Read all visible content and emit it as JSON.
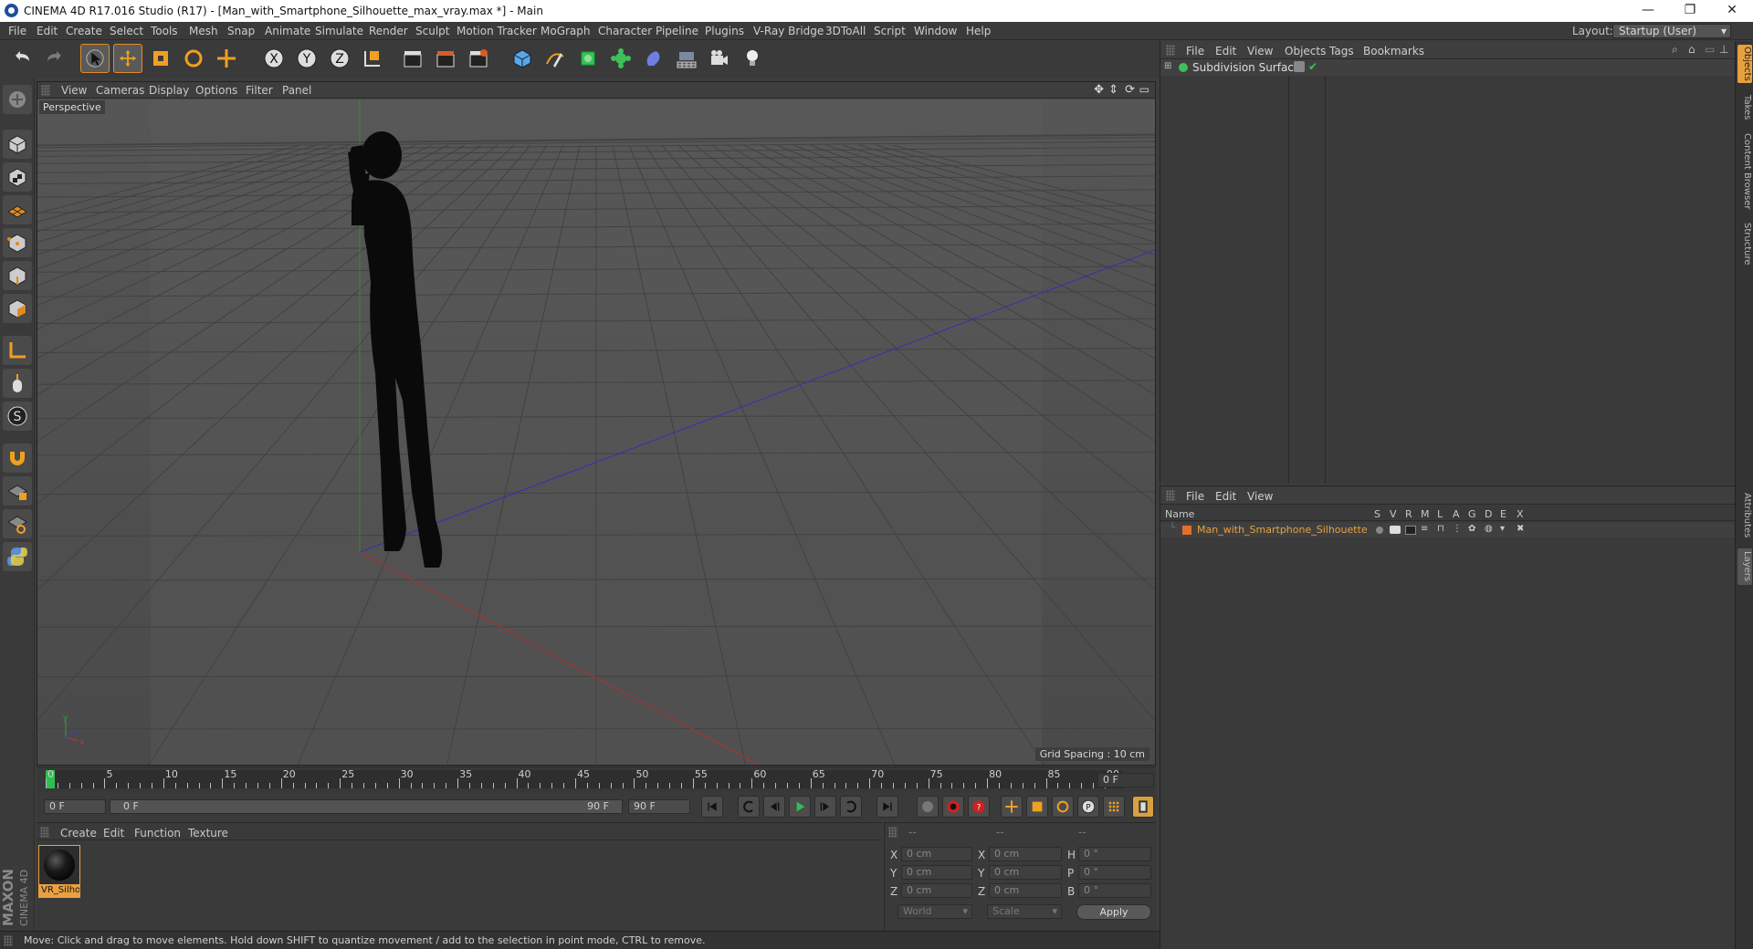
{
  "window": {
    "title": "CINEMA 4D R17.016 Studio (R17) - [Man_with_Smartphone_Silhouette_max_vray.max *] - Main",
    "min": "—",
    "restore": "❐",
    "close": "✕"
  },
  "menubar": {
    "items": [
      "File",
      "Edit",
      "Create",
      "Select",
      "Tools",
      "Mesh",
      "Snap",
      "Animate",
      "Simulate",
      "Render",
      "Sculpt",
      "Motion Tracker",
      "MoGraph",
      "Character",
      "Pipeline",
      "Plugins",
      "V-Ray Bridge",
      "3DToAll",
      "Script",
      "Window",
      "Help"
    ],
    "layout_label": "Layout:",
    "layout_value": "Startup (User)"
  },
  "viewport": {
    "menu": [
      "View",
      "Cameras",
      "Display",
      "Options",
      "Filter",
      "Panel"
    ],
    "label": "Perspective",
    "grid_info": "Grid Spacing : 10 cm",
    "axis_y": "y",
    "axis_x": "x",
    "axis_z": "z"
  },
  "timeline": {
    "ticks": [
      "0",
      "5",
      "10",
      "15",
      "20",
      "25",
      "30",
      "35",
      "40",
      "45",
      "50",
      "55",
      "60",
      "65",
      "70",
      "75",
      "80",
      "85",
      "90"
    ],
    "current_frame": "0 F",
    "start": "0 F",
    "range_start": "0 F",
    "range_end": "90 F",
    "end": "90 F"
  },
  "materials": {
    "menu": [
      "Create",
      "Edit",
      "Function",
      "Texture"
    ],
    "items": [
      {
        "name": "VR_Silhou"
      }
    ]
  },
  "coords": {
    "headers": [
      "--",
      "--",
      "--"
    ],
    "rows": [
      {
        "a": "X",
        "av": "0 cm",
        "b": "X",
        "bv": "0 cm",
        "c": "H",
        "cv": "0 °"
      },
      {
        "a": "Y",
        "av": "0 cm",
        "b": "Y",
        "bv": "0 cm",
        "c": "P",
        "cv": "0 °"
      },
      {
        "a": "Z",
        "av": "0 cm",
        "b": "Z",
        "bv": "0 cm",
        "c": "B",
        "cv": "0 °"
      }
    ],
    "world": "World",
    "scale": "Scale",
    "apply": "Apply"
  },
  "status": {
    "text": "Move: Click and drag to move elements. Hold down SHIFT to quantize movement / add to the selection in point mode, CTRL to remove."
  },
  "objects": {
    "menu": [
      "File",
      "Edit",
      "View",
      "Objects",
      "Tags",
      "Bookmarks"
    ],
    "items": [
      {
        "name": "Subdivision Surface"
      }
    ]
  },
  "layers": {
    "menu": [
      "File",
      "Edit",
      "View"
    ],
    "col_name": "Name",
    "cols": [
      "S",
      "V",
      "R",
      "M",
      "L",
      "A",
      "G",
      "D",
      "E",
      "X"
    ],
    "items": [
      {
        "name": "Man_with_Smartphone_Silhouette",
        "color": "#e0702a"
      }
    ]
  },
  "sidetabs": [
    "Objects",
    "Takes",
    "Content Browser",
    "Structure",
    "Attributes",
    "Layers"
  ],
  "brand": {
    "maxon": "MAXON",
    "c4d": "CINEMA 4D"
  }
}
